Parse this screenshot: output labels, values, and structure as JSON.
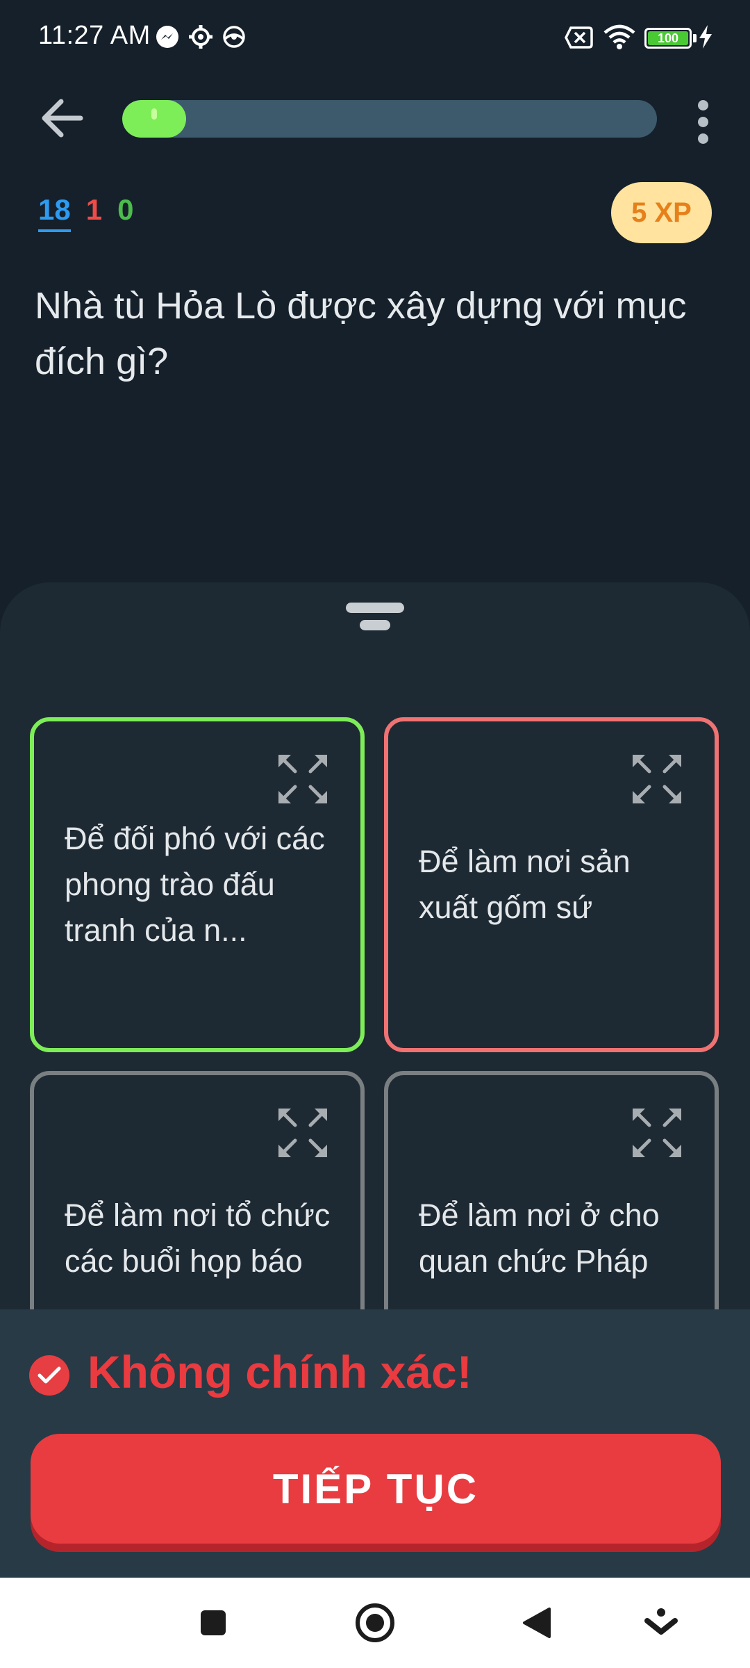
{
  "status_bar": {
    "time": "11:27 AM",
    "battery_level": "100",
    "icons": [
      "messenger-icon",
      "settings-icon",
      "vpn-icon",
      "no-sim-icon",
      "wifi-icon",
      "battery-icon",
      "charging-icon"
    ]
  },
  "header": {
    "back_icon": "arrow-left-icon",
    "progress_fraction": 0.12,
    "menu_icon": "more-vertical-icon"
  },
  "counters": {
    "total": "18",
    "wrong": "1",
    "correct": "0"
  },
  "xp_badge": "5 XP",
  "question": "Nhà tù Hỏa Lò được xây dựng với mục đích gì?",
  "options": [
    {
      "text": "Để đối phó với các phong trào đấu tranh của n...",
      "state": "correct"
    },
    {
      "text": "Để làm nơi sản xuất gốm sứ",
      "state": "wrong"
    },
    {
      "text": "Để làm nơi tổ chức các buổi họp báo",
      "state": "neutral"
    },
    {
      "text": "Để làm nơi ở cho quan chức Pháp",
      "state": "neutral"
    }
  ],
  "feedback": {
    "title": "Không chính xác!",
    "button_label": "TIẾP TỤC"
  },
  "colors": {
    "correct": "#7ded58",
    "wrong": "#f07272",
    "accent_red": "#e83c41",
    "xp_bg": "#ffe39e",
    "xp_text": "#e6801a"
  }
}
